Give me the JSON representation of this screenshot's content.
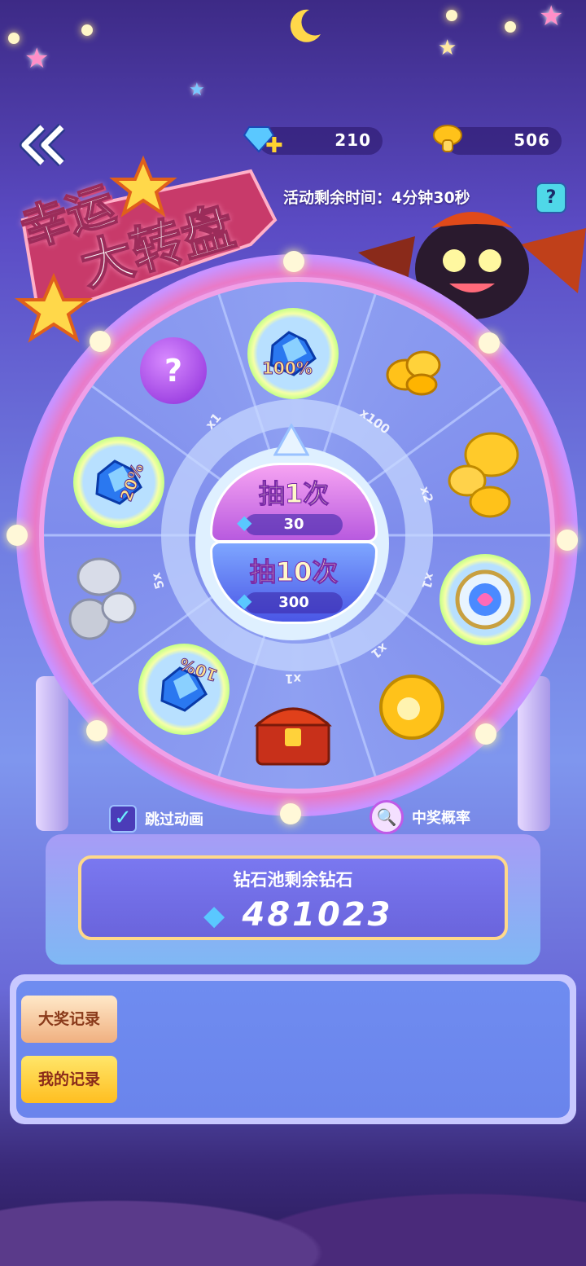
{
  "header": {
    "back_icon": "double-chevron-left-icon",
    "diamond_balance": "210",
    "mushroom_balance": "506",
    "timer_text": "活动剩余时间：4分钟30秒",
    "help_label": "?"
  },
  "title": {
    "line1": "幸运",
    "line2": "大转盘"
  },
  "wheel": {
    "prizes": [
      {
        "icon": "diamond-pile-icon",
        "label": "100%"
      },
      {
        "icon": "gold-coins-icon",
        "label": ""
      },
      {
        "icon": "golden-mushrooms-icon",
        "label": ""
      },
      {
        "icon": "rainbow-medal-icon",
        "label": ""
      },
      {
        "icon": "gold-dragon-coin-icon",
        "label": ""
      },
      {
        "icon": "treasure-chest-icon",
        "label": ""
      },
      {
        "icon": "diamond-pile-icon",
        "label": "10%"
      },
      {
        "icon": "silver-mushrooms-icon",
        "label": ""
      },
      {
        "icon": "diamond-pile-icon",
        "label": "20%"
      },
      {
        "icon": "mystery-orb-icon",
        "label": ""
      }
    ],
    "multipliers": {
      "m1": "x1",
      "m100": "x100",
      "m2": "x2",
      "m1b": "x1",
      "m1c": "x1",
      "m1d": "x1",
      "m5": "5x"
    },
    "draw_once": {
      "label": "抽1次",
      "cost": "30"
    },
    "draw_ten": {
      "label": "抽10次",
      "cost": "300"
    }
  },
  "options": {
    "skip_animation": "跳过动画",
    "win_rate": "中奖概率"
  },
  "pool": {
    "label": "钻石池剩余钻石",
    "value": "481023"
  },
  "records": {
    "grand_prize": "大奖记录",
    "my_records": "我的记录"
  },
  "colors": {
    "accent_gold": "#ffd230",
    "diamond_blue": "#5ac8ff",
    "btn_purple": "#b85adf",
    "btn_blue": "#4a56e6"
  }
}
